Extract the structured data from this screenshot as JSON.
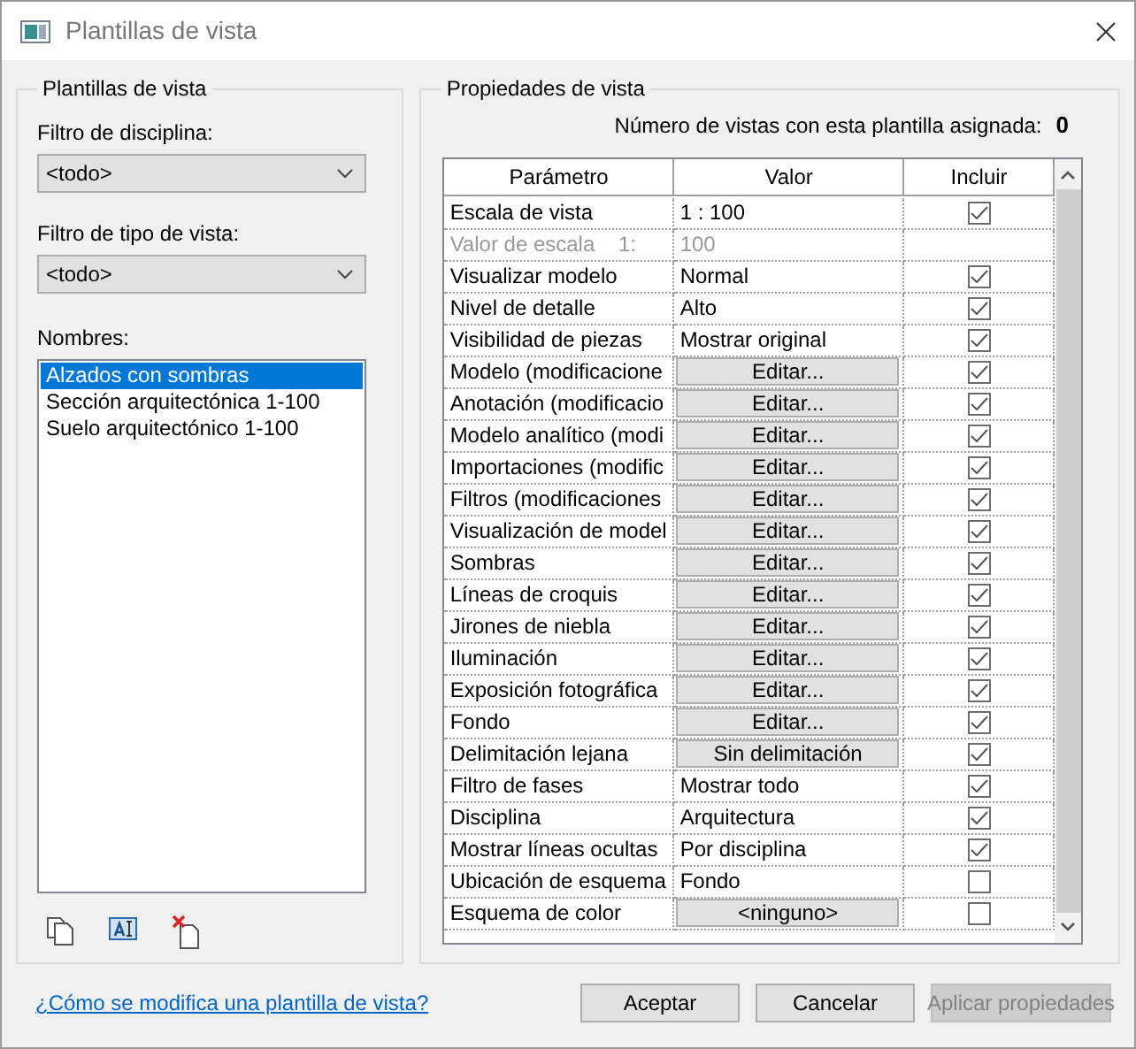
{
  "window": {
    "title": "Plantillas de vista"
  },
  "templates_panel": {
    "legend": "Plantillas de vista",
    "discipline_filter": {
      "label": "Filtro de disciplina:",
      "value": "<todo>"
    },
    "view_type_filter": {
      "label": "Filtro de tipo de vista:",
      "value": "<todo>"
    },
    "names_label": "Nombres:",
    "names": [
      {
        "text": "Alzados con sombras",
        "selected": true
      },
      {
        "text": "Sección arquitectónica  1-100",
        "selected": false
      },
      {
        "text": "Suelo arquitectónico 1-100",
        "selected": false
      }
    ]
  },
  "properties_panel": {
    "legend": "Propiedades de vista",
    "count_label": "Número de vistas con esta plantilla asignada:",
    "count": "0",
    "table": {
      "columns": [
        "Parámetro",
        "Valor",
        "Incluir"
      ],
      "rows": [
        {
          "kind": "text",
          "parameter": "Escala de vista",
          "value": "1 : 100",
          "checked": true
        },
        {
          "kind": "readonly",
          "parameter": "Valor de escala    1:",
          "value": "100"
        },
        {
          "kind": "text",
          "parameter": "Visualizar modelo",
          "value": "Normal",
          "checked": true
        },
        {
          "kind": "text",
          "parameter": "Nivel de detalle",
          "value": "Alto",
          "checked": true
        },
        {
          "kind": "text",
          "parameter": "Visibilidad de piezas",
          "value": "Mostrar original",
          "checked": true
        },
        {
          "kind": "button",
          "parameter": "Modelo (modificacione",
          "value": "Editar...",
          "checked": true
        },
        {
          "kind": "button",
          "parameter": "Anotación (modificacio",
          "value": "Editar...",
          "checked": true
        },
        {
          "kind": "button",
          "parameter": "Modelo analítico (modi",
          "value": "Editar...",
          "checked": true
        },
        {
          "kind": "button",
          "parameter": "Importaciones (modific",
          "value": "Editar...",
          "checked": true
        },
        {
          "kind": "button",
          "parameter": "Filtros (modificaciones",
          "value": "Editar...",
          "checked": true
        },
        {
          "kind": "button",
          "parameter": "Visualización de model",
          "value": "Editar...",
          "checked": true
        },
        {
          "kind": "button",
          "parameter": "Sombras",
          "value": "Editar...",
          "checked": true
        },
        {
          "kind": "button",
          "parameter": "Líneas de croquis",
          "value": "Editar...",
          "checked": true
        },
        {
          "kind": "button",
          "parameter": "Jirones de niebla",
          "value": "Editar...",
          "checked": true
        },
        {
          "kind": "button",
          "parameter": "Iluminación",
          "value": "Editar...",
          "checked": true
        },
        {
          "kind": "button",
          "parameter": "Exposición fotográfica",
          "value": "Editar...",
          "checked": true
        },
        {
          "kind": "button",
          "parameter": "Fondo",
          "value": "Editar...",
          "checked": true
        },
        {
          "kind": "button",
          "parameter": "Delimitación lejana",
          "value": "Sin delimitación",
          "checked": true
        },
        {
          "kind": "text",
          "parameter": "Filtro de fases",
          "value": "Mostrar todo",
          "checked": true
        },
        {
          "kind": "text",
          "parameter": "Disciplina",
          "value": "Arquitectura",
          "checked": true
        },
        {
          "kind": "text",
          "parameter": "Mostrar líneas ocultas",
          "value": "Por disciplina",
          "checked": true
        },
        {
          "kind": "text",
          "parameter": "Ubicación de esquema",
          "value": "Fondo",
          "checked": false
        },
        {
          "kind": "button",
          "parameter": "Esquema de color",
          "value": "<ninguno>",
          "checked": false
        }
      ]
    }
  },
  "help_link": "¿Cómo se modifica una plantilla de vista?",
  "buttons": [
    {
      "label": "Aceptar",
      "disabled": false
    },
    {
      "label": "Cancelar",
      "disabled": false
    },
    {
      "label": "Aplicar propiedades",
      "disabled": true
    }
  ]
}
